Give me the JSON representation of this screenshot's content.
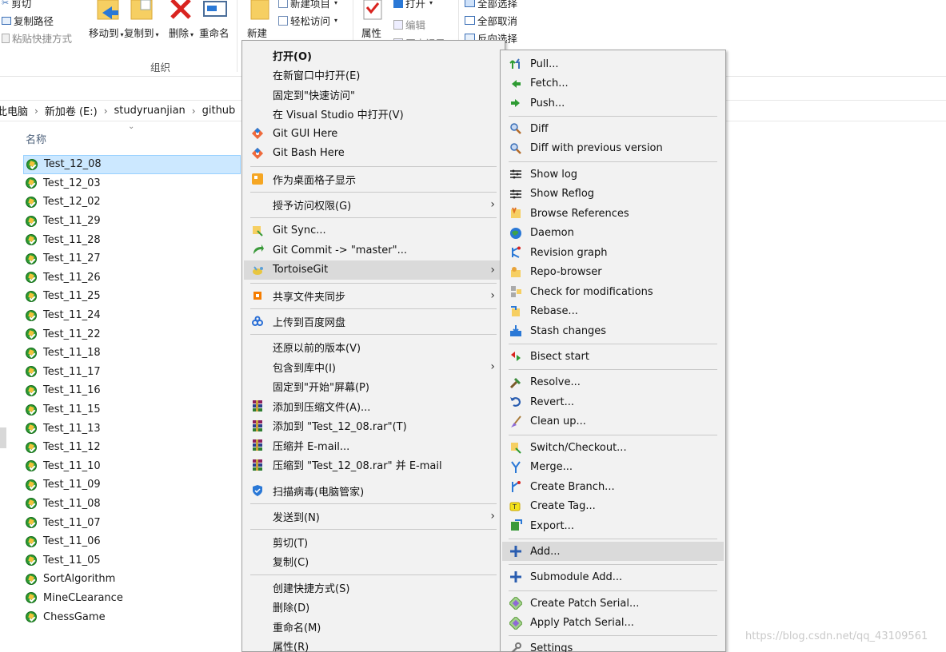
{
  "ribbon": {
    "cut": "剪切",
    "copy_path": "复制路径",
    "paste_shortcut": "粘贴快捷方式",
    "move_to": "移动到",
    "copy_to": "复制到",
    "delete": "删除",
    "rename": "重命名",
    "organize_group": "组织",
    "new_folder": "新建",
    "new_item": "新建项目",
    "easy_access": "轻松访问",
    "properties": "属性",
    "open": "打开",
    "edit": "编辑",
    "history": "历史记录",
    "select_all": "全部选择",
    "select_none": "全部取消",
    "invert_selection": "反向选择"
  },
  "breadcrumb": [
    "此电脑",
    "新加卷 (E:)",
    "studyruanjian",
    "github"
  ],
  "file_list": {
    "column_name": "名称",
    "items": [
      "Test_12_08",
      "Test_12_03",
      "Test_12_02",
      "Test_11_29",
      "Test_11_28",
      "Test_11_27",
      "Test_11_26",
      "Test_11_25",
      "Test_11_24",
      "Test_11_22",
      "Test_11_18",
      "Test_11_17",
      "Test_11_16",
      "Test_11_15",
      "Test_11_13",
      "Test_11_12",
      "Test_11_10",
      "Test_11_09",
      "Test_11_08",
      "Test_11_07",
      "Test_11_06",
      "Test_11_05",
      "SortAlgorithm",
      "MineCLearance",
      "ChessGame"
    ],
    "selected": "Test_12_08"
  },
  "context_menu": {
    "items": [
      {
        "label": "打开(O)",
        "icon": "none"
      },
      {
        "label": "在新窗口中打开(E)",
        "icon": "none"
      },
      {
        "label": "固定到\"快速访问\"",
        "icon": "none"
      },
      {
        "label": "在 Visual Studio 中打开(V)",
        "icon": "none"
      },
      {
        "label": "Git GUI Here",
        "icon": "git-icon"
      },
      {
        "label": "Git Bash Here",
        "icon": "git-icon"
      },
      {
        "label": "作为桌面格子显示",
        "icon": "desktop-grid-icon"
      },
      {
        "label": "授予访问权限(G)",
        "icon": "none"
      },
      {
        "label": "Git Sync...",
        "icon": "sync-icon"
      },
      {
        "label": "Git Commit -> \"master\"...",
        "icon": "commit-icon"
      },
      {
        "label": "TortoiseGit",
        "icon": "tortoise-icon"
      },
      {
        "label": "共享文件夹同步",
        "icon": "share-sync-icon"
      },
      {
        "label": "上传到百度网盘",
        "icon": "baidu-cloud-icon"
      },
      {
        "label": "还原以前的版本(V)",
        "icon": "none"
      },
      {
        "label": "包含到库中(I)",
        "icon": "none"
      },
      {
        "label": "固定到\"开始\"屏幕(P)",
        "icon": "none"
      },
      {
        "label": "添加到压缩文件(A)...",
        "icon": "winrar-icon"
      },
      {
        "label": "添加到 \"Test_12_08.rar\"(T)",
        "icon": "winrar-icon"
      },
      {
        "label": "压缩并 E-mail...",
        "icon": "winrar-icon"
      },
      {
        "label": "压缩到 \"Test_12_08.rar\" 并 E-mail",
        "icon": "winrar-icon"
      },
      {
        "label": "扫描病毒(电脑管家)",
        "icon": "shield-icon"
      },
      {
        "label": "发送到(N)",
        "icon": "none"
      },
      {
        "label": "剪切(T)",
        "icon": "none"
      },
      {
        "label": "复制(C)",
        "icon": "none"
      },
      {
        "label": "创建快捷方式(S)",
        "icon": "none"
      },
      {
        "label": "删除(D)",
        "icon": "none"
      },
      {
        "label": "重命名(M)",
        "icon": "none"
      },
      {
        "label": "属性(R)",
        "icon": "none"
      }
    ]
  },
  "tortoisegit_menu": {
    "items": [
      {
        "label": "Pull...",
        "icon": "pull-icon"
      },
      {
        "label": "Fetch...",
        "icon": "fetch-icon"
      },
      {
        "label": "Push...",
        "icon": "push-icon"
      },
      {
        "label": "Diff",
        "icon": "diff-icon"
      },
      {
        "label": "Diff with previous version",
        "icon": "diff-icon"
      },
      {
        "label": "Show log",
        "icon": "log-icon"
      },
      {
        "label": "Show Reflog",
        "icon": "log-icon"
      },
      {
        "label": "Browse References",
        "icon": "references-icon"
      },
      {
        "label": "Daemon",
        "icon": "daemon-icon"
      },
      {
        "label": "Revision graph",
        "icon": "graph-icon"
      },
      {
        "label": "Repo-browser",
        "icon": "repo-browser-icon"
      },
      {
        "label": "Check for modifications",
        "icon": "check-icon"
      },
      {
        "label": "Rebase...",
        "icon": "rebase-icon"
      },
      {
        "label": "Stash changes",
        "icon": "stash-icon"
      },
      {
        "label": "Bisect start",
        "icon": "bisect-icon"
      },
      {
        "label": "Resolve...",
        "icon": "resolve-icon"
      },
      {
        "label": "Revert...",
        "icon": "revert-icon"
      },
      {
        "label": "Clean up...",
        "icon": "cleanup-icon"
      },
      {
        "label": "Switch/Checkout...",
        "icon": "switch-icon"
      },
      {
        "label": "Merge...",
        "icon": "merge-icon"
      },
      {
        "label": "Create Branch...",
        "icon": "branch-icon"
      },
      {
        "label": "Create Tag...",
        "icon": "tag-icon"
      },
      {
        "label": "Export...",
        "icon": "export-icon"
      },
      {
        "label": "Add...",
        "icon": "add-icon"
      },
      {
        "label": "Submodule Add...",
        "icon": "add-icon"
      },
      {
        "label": "Create Patch Serial...",
        "icon": "patch-icon"
      },
      {
        "label": "Apply Patch Serial...",
        "icon": "patch-icon"
      },
      {
        "label": "Settings",
        "icon": "settings-icon"
      }
    ]
  },
  "watermark": "https://blog.csdn.net/qq_43109561"
}
